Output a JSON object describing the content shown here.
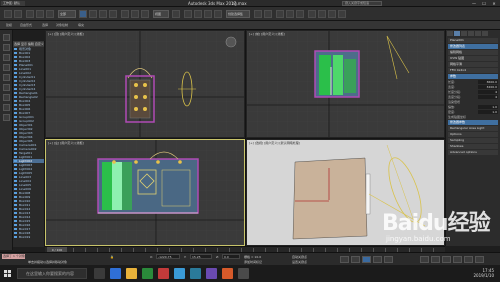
{
  "window": {
    "workspace_label": "工作区: 默认",
    "app_title": "Autodesk 3ds Max 2017",
    "file_name": "zg.max",
    "search_placeholder": "键入关键字或短语",
    "min": "—",
    "max": "☐",
    "close": "✕"
  },
  "ribbon": {
    "tabs": [
      "建模",
      "自由形式",
      "选择",
      "对象绘制",
      "填充"
    ]
  },
  "toolbar": {
    "selection_filter": "全部",
    "view_dropdown": "视图",
    "selection_set": "创建选择集"
  },
  "explorer": {
    "header": "选择 显示 编辑 自定义",
    "rows": [
      "场景对象",
      "Box001",
      "Box002",
      "Box003",
      "Plane001",
      "Line001",
      "Line002",
      "Cylinder01",
      "Cylinder02",
      "Cylinder03",
      "Cylinder04",
      "Rectangle01",
      "Rectangle02",
      "Box004",
      "Box005",
      "Box006",
      "Box007",
      "Group001",
      "Group002",
      "Object01",
      "Object02",
      "Object03",
      "Object04",
      "Object05",
      "Camera001",
      "Camera002",
      "Target01",
      "Light001",
      "Light002",
      "Light003",
      "Light004",
      "Light005",
      "Line003",
      "Line004",
      "Line005",
      "Line006",
      "Box008",
      "Box009",
      "Box010",
      "Box011",
      "Box012",
      "Box013",
      "Box014",
      "Box015",
      "Box016",
      "Box017",
      "Box018",
      "Box019"
    ],
    "selected_index": 28
  },
  "viewports": {
    "top": "[+] [顶] [用户定义] [线框]",
    "front": "[+] [前] [用户定义] [线框]",
    "left": "[+] [左] [用户定义] [线框]",
    "perspective": "[+] [透视] [用户定义] [默认明暗处理]"
  },
  "command_panel": {
    "header": "Plane001",
    "modifier_list": "修改器列表",
    "buttons": [
      "编辑网格",
      "UVW 贴图",
      "网格平滑",
      "FFD 4x4x4"
    ],
    "params_title": "参数",
    "fields": [
      {
        "label": "长度:",
        "value": "3600.0"
      },
      {
        "label": "宽度:",
        "value": "3200.0"
      },
      {
        "label": "长度分段:",
        "value": "4"
      },
      {
        "label": "宽度分段:",
        "value": "4"
      }
    ],
    "render_mult": "渲染倍增",
    "scale_label": "缩放:",
    "scale_value": "1.0",
    "density_label": "密度:",
    "density_value": "1.0",
    "gen_map_coords": "生成贴图坐标",
    "sections": [
      "修改器参数",
      "Rectangular Area Light",
      "Options",
      "Sampling",
      "Shadows",
      "Advanced options"
    ]
  },
  "timeline": {
    "frame": "0 / 100"
  },
  "status": {
    "prompt": "选择了 1 个对象",
    "hint": "单击并拖动以选择并移动对象",
    "x_label": "X:",
    "x_value": "-1220.75",
    "y_label": "Y:",
    "y_value": "15.25",
    "z_label": "Z:",
    "z_value": "0.0",
    "grid": "栅格 = 10.0",
    "add_time_tag": "添加时间标记",
    "auto_key": "自动关键点",
    "set_key": "设置关键点"
  },
  "taskbar": {
    "search_placeholder": "在这里输入你要搜索的内容",
    "time": "17:45",
    "date": "2019/1/10"
  },
  "watermark": {
    "brand": "Baidu经验",
    "site": "jingyan.baidu.com"
  }
}
